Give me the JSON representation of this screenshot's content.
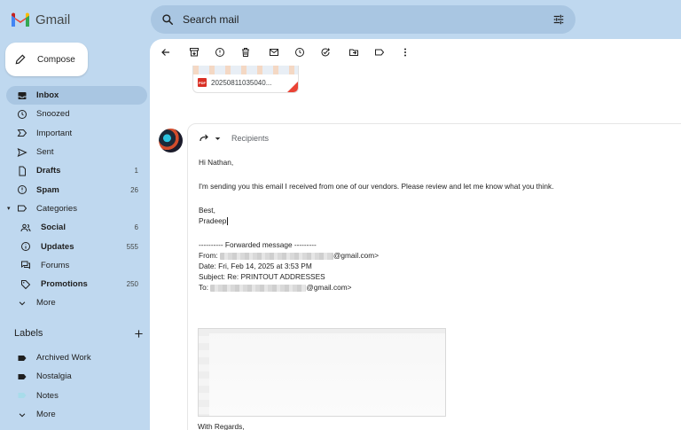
{
  "app": {
    "name": "Gmail"
  },
  "search": {
    "placeholder": "Search mail"
  },
  "sidebar": {
    "compose_label": "Compose",
    "items": [
      {
        "label": "Inbox",
        "count": ""
      },
      {
        "label": "Snoozed",
        "count": ""
      },
      {
        "label": "Important",
        "count": ""
      },
      {
        "label": "Sent",
        "count": ""
      },
      {
        "label": "Drafts",
        "count": "1"
      },
      {
        "label": "Spam",
        "count": "26"
      },
      {
        "label": "Categories",
        "count": ""
      },
      {
        "label": "Social",
        "count": "6"
      },
      {
        "label": "Updates",
        "count": "555"
      },
      {
        "label": "Forums",
        "count": ""
      },
      {
        "label": "Promotions",
        "count": "250"
      },
      {
        "label": "More",
        "count": ""
      }
    ],
    "labels_title": "Labels",
    "labels": [
      {
        "label": "Archived Work"
      },
      {
        "label": "Nostalgia"
      },
      {
        "label": "Notes"
      },
      {
        "label": "More"
      }
    ]
  },
  "attachment": {
    "name": "20250811035040..."
  },
  "email": {
    "recipients_label": "Recipients",
    "greeting": "Hi Nathan,",
    "message": "I'm sending you this email I received from one of our vendors. Please review and let me know what you think.",
    "signoff": "Best,",
    "signature": "Pradeep",
    "forward_header": "---------- Forwarded message ---------",
    "from_label": "From:",
    "from_suffix": "@gmail.com>",
    "date_line": "Date: Fri, Feb 14, 2025 at 3:53 PM",
    "subject_line": "Subject: Re: PRINTOUT ADDRESSES",
    "to_label": "To:",
    "to_suffix": "@gmail.com>",
    "regards": "With Regards,"
  },
  "colors": {
    "background": "#bfd8ef",
    "active_nav": "#a9c6e2",
    "gmail_red": "#ea4335",
    "gmail_blue": "#4285f4",
    "gmail_green": "#34a853",
    "gmail_yellow": "#fbbc04"
  }
}
